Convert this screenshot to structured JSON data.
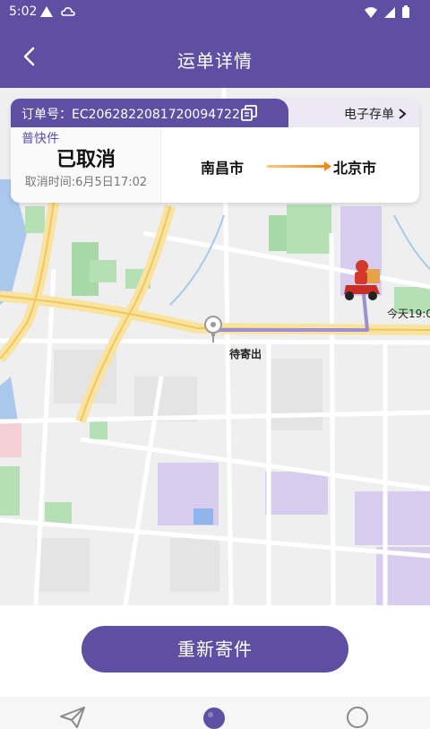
{
  "status_bar": {
    "time": "5:02"
  },
  "header": {
    "title": "运单详情"
  },
  "order": {
    "number_label": "订单号：EC2062822081720094722",
    "e_receipt_label": "电子存单",
    "service_type": "普快件",
    "status": "已取消",
    "cancel_time": "取消时间:6月5日17:02",
    "from_city": "南昌市",
    "to_city": "北京市"
  },
  "map": {
    "courier_eta": "今天19:0",
    "start_label": "待寄出"
  },
  "actions": {
    "resend_label": "重新寄件"
  },
  "tabs": [
    {
      "name": "send",
      "icon": "paper-plane-icon"
    },
    {
      "name": "track",
      "icon": "search-icon"
    },
    {
      "name": "profile",
      "icon": "circle-icon"
    }
  ],
  "colors": {
    "primary": "#5e4fa2",
    "route_orange": "#f39b1e"
  }
}
